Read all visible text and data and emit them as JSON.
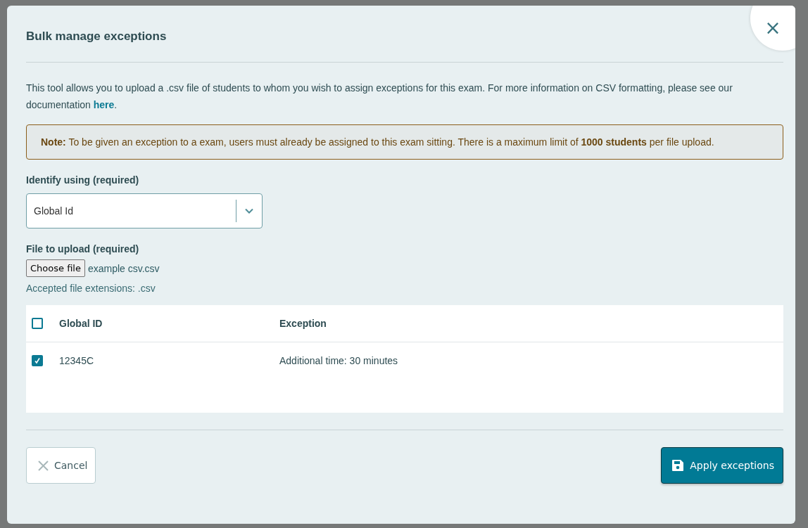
{
  "dialog": {
    "title": "Bulk manage exceptions",
    "close_icon": "×",
    "intro": {
      "text": "This tool allows you to upload a .csv file of students to whom you wish to assign exceptions for this exam. For more information on CSV formatting, please see our documentation ",
      "link": "here",
      "after": "."
    },
    "note": "**Note:** To be given an exception to a exam, users must already be assigned to this exam sitting. There is a maximum limit of **1000 students** per file upload.",
    "identify": {
      "label": "Identify using (required)",
      "value": "Global Id"
    },
    "file": {
      "label": "File to upload (required)",
      "button": "Choose file",
      "filename": "example csv.csv",
      "hint": "Accepted file extensions: .csv"
    },
    "table": {
      "select_all": {
        "checked": false
      },
      "columns": [
        "Global ID",
        "Exception"
      ],
      "rows": [
        {
          "checked": true,
          "cells": [
            "12345C",
            "Additional time: 30 minutes"
          ]
        }
      ]
    },
    "buttons": [
      {
        "kind": "cancel",
        "label": "Cancel"
      },
      {
        "kind": "primary",
        "label": "Apply exceptions"
      }
    ]
  }
}
